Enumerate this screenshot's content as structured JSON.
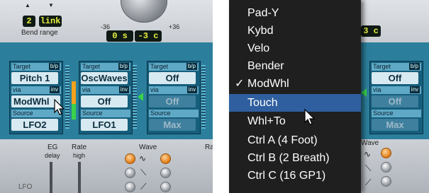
{
  "left_panel": {
    "bend_range": {
      "value": "2",
      "link": "link",
      "label": "Bend range"
    },
    "tuning_display": {
      "left": "0 s",
      "right": "-3 c"
    },
    "scale_marks": {
      "left": "-36",
      "right": "+36"
    },
    "mod_slots": [
      {
        "target_label": "Target",
        "target_bp": "b/p",
        "target_value": "Pitch 1",
        "via_label": "via",
        "via_inv": "inv",
        "via_value": "ModWhl",
        "source_label": "Source",
        "source_value": "LFO2"
      },
      {
        "target_label": "Target",
        "target_bp": "b/p",
        "target_value": "OscWaves",
        "via_label": "via",
        "via_inv": "inv",
        "via_value": "Off",
        "source_label": "Source",
        "source_value": "LFO1"
      },
      {
        "target_label": "Target",
        "target_bp": "b/p",
        "target_value": "Off",
        "via_label": "via",
        "via_inv": "inv",
        "via_value": "Off",
        "source_label": "Source",
        "source_value": "Max"
      }
    ],
    "lfo": {
      "eg_label": "EG",
      "delay_label": "delay",
      "rate_label": "Rate",
      "high_label": "high",
      "wave_label": "Wave",
      "lfo_label": "LFO",
      "partial_label": "Ra"
    }
  },
  "right_panel": {
    "lcd_partial": "3 c",
    "mod_slot": {
      "target_label": "Target",
      "target_bp": "b/p",
      "target_value": "Off",
      "via_label": "via",
      "via_inv": "inv",
      "via_value": "Off",
      "source_label": "Source",
      "source_value": "Max"
    },
    "wave_label": "Wave"
  },
  "menu": {
    "items": [
      {
        "label": "Pad-Y",
        "checked": false,
        "highlighted": false
      },
      {
        "label": "Kybd",
        "checked": false,
        "highlighted": false
      },
      {
        "label": "Velo",
        "checked": false,
        "highlighted": false
      },
      {
        "label": "Bender",
        "checked": false,
        "highlighted": false
      },
      {
        "label": "ModWhl",
        "checked": true,
        "highlighted": false
      },
      {
        "label": "Touch",
        "checked": false,
        "highlighted": true
      },
      {
        "label": "Whl+To",
        "checked": false,
        "highlighted": false
      },
      {
        "label": "Ctrl A (4 Foot)",
        "checked": false,
        "highlighted": false
      },
      {
        "label": "Ctrl B (2 Breath)",
        "checked": false,
        "highlighted": false
      },
      {
        "label": "Ctrl C (16 GP1)",
        "checked": false,
        "highlighted": false
      }
    ],
    "checkmark": "✓",
    "highlight_color": "#2f5f9f"
  }
}
